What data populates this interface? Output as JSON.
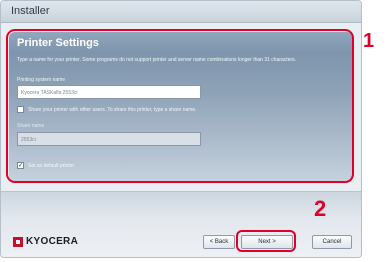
{
  "window": {
    "title": "Installer"
  },
  "panel": {
    "title": "Printer Settings",
    "description": "Type a name for your printer. Some programs do not support printer and server name combinations longer than 31 characters.",
    "printer_name_label": "Printing system name",
    "printer_name_value": "Kyocera TASKalfa 2553ci",
    "share_label": "Share your printer with other users. To share this printer, type a share name.",
    "share_checked": false,
    "share_name_label": "Share name",
    "share_name_value": "2553ci",
    "default_label": "Set as default printer",
    "default_checked": true
  },
  "buttons": {
    "back": "< Back",
    "next": "Next >",
    "cancel": "Cancel"
  },
  "brand": {
    "logo_text": "KYOCERA",
    "logo_color": "#c8102e"
  },
  "callouts": {
    "one": "1",
    "two": "2",
    "color": "#e0002a"
  }
}
